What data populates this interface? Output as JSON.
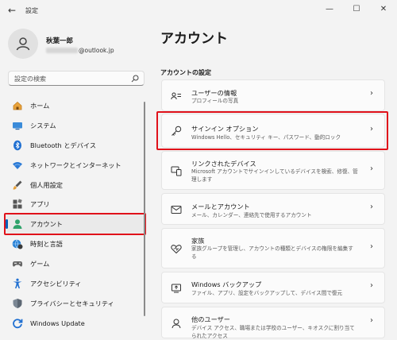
{
  "window": {
    "title": "設定",
    "back_glyph": "←",
    "minimize_glyph": "—",
    "maximize_glyph": "☐",
    "close_glyph": "✕"
  },
  "profile": {
    "name": "秋葉一郎",
    "email_suffix": "@outlook.jp"
  },
  "search": {
    "placeholder": "設定の検索"
  },
  "sidebar": {
    "items": [
      {
        "label": "ホーム",
        "icon": "home-icon"
      },
      {
        "label": "システム",
        "icon": "monitor-icon"
      },
      {
        "label": "Bluetooth とデバイス",
        "icon": "bluetooth-icon"
      },
      {
        "label": "ネットワークとインターネット",
        "icon": "wifi-icon"
      },
      {
        "label": "個人用設定",
        "icon": "paintbrush-icon"
      },
      {
        "label": "アプリ",
        "icon": "apps-icon"
      },
      {
        "label": "アカウント",
        "icon": "person-icon",
        "selected": true
      },
      {
        "label": "時刻と言語",
        "icon": "globe-clock-icon"
      },
      {
        "label": "ゲーム",
        "icon": "gamepad-icon"
      },
      {
        "label": "アクセシビリティ",
        "icon": "accessibility-icon"
      },
      {
        "label": "プライバシーとセキュリティ",
        "icon": "shield-icon"
      },
      {
        "label": "Windows Update",
        "icon": "update-icon"
      }
    ]
  },
  "main": {
    "title": "アカウント",
    "section": "アカウントの設定",
    "cards": [
      {
        "title": "ユーザーの情報",
        "subtitle": "プロフィールの写真",
        "icon": "user-info-icon"
      },
      {
        "title": "サインイン オプション",
        "subtitle": "Windows Hello、セキュリティ キー、パスワード、動的ロック",
        "icon": "key-icon"
      },
      {
        "title": "リンクされたデバイス",
        "subtitle": "Microsoft アカウントでサインインしているデバイスを検索、修復、管理します",
        "icon": "linked-devices-icon"
      },
      {
        "title": "メールとアカウント",
        "subtitle": "メール、カレンダー、連絡先で使用するアカウント",
        "icon": "mail-icon"
      },
      {
        "title": "家族",
        "subtitle": "家族グループを管理し、アカウントの種類とデバイスの権限を編集する",
        "icon": "family-heart-icon"
      },
      {
        "title": "Windows バックアップ",
        "subtitle": "ファイル、アプリ、設定をバックアップして、デバイス間で復元",
        "icon": "backup-icon"
      },
      {
        "title": "他のユーザー",
        "subtitle": "デバイス アクセス、職場または学校のユーザー、キオスクに割り当てられたアクセス",
        "icon": "other-users-icon"
      }
    ],
    "chevron": "›"
  },
  "colors": {
    "highlight_box": "#e0111a",
    "accent": "#005fb8"
  }
}
